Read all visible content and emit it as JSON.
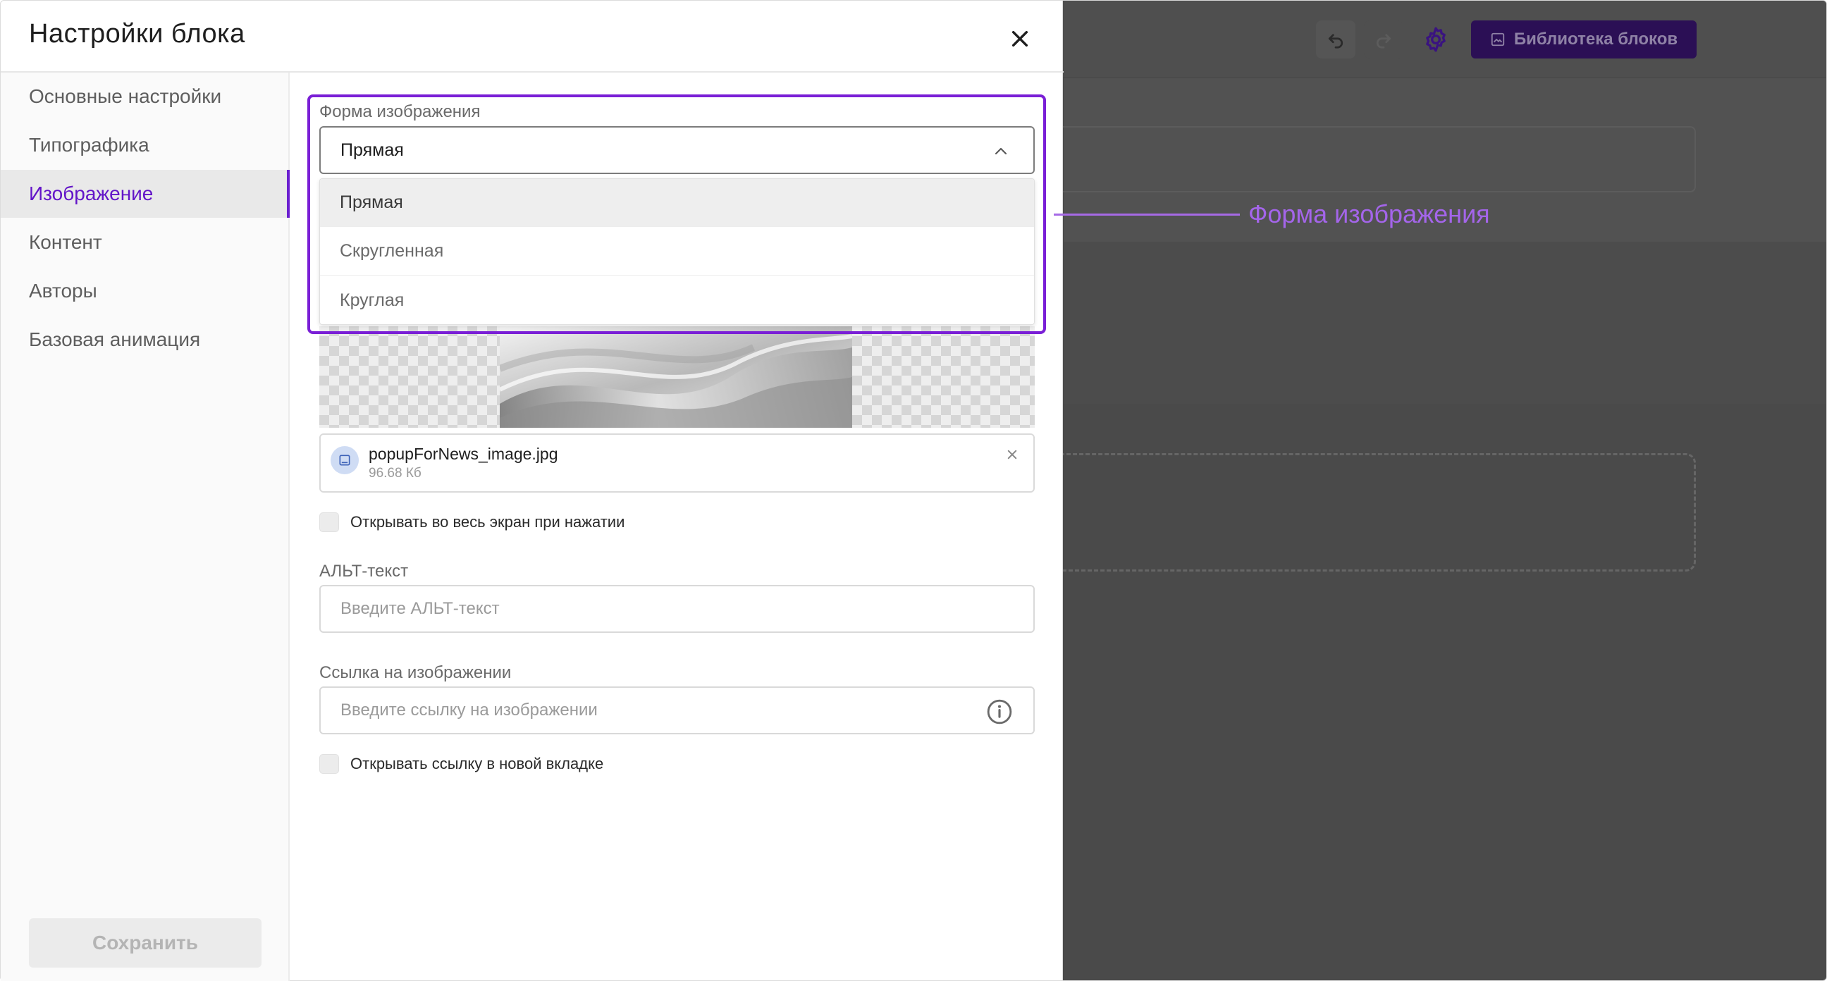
{
  "editor": {
    "library_label": "Библиотека блоков",
    "icons": {
      "undo": "undo-icon",
      "redo": "redo-icon",
      "settings": "gear-icon",
      "library": "image-icon"
    },
    "colors": {
      "accent": "#6a1fd0",
      "library_button": "#2b0f55"
    }
  },
  "panel": {
    "title": "Настройки блока",
    "close_icon": "close-icon",
    "save_label": "Сохранить"
  },
  "sidebar": {
    "items": [
      {
        "label": "Основные настройки",
        "active": false
      },
      {
        "label": "Типографика",
        "active": false
      },
      {
        "label": "Изображение",
        "active": true
      },
      {
        "label": "Контент",
        "active": false
      },
      {
        "label": "Авторы",
        "active": false
      },
      {
        "label": "Базовая анимация",
        "active": false
      }
    ]
  },
  "image_shape": {
    "label": "Форма изображения",
    "selected": "Прямая",
    "options": [
      "Прямая",
      "Скругленная",
      "Круглая"
    ],
    "expanded": true
  },
  "callout": {
    "label": "Форма изображения"
  },
  "file": {
    "name": "popupForNews_image.jpg",
    "size": "96.68 Кб"
  },
  "fullscreen_checkbox": {
    "label": "Открывать во весь экран при нажатии",
    "checked": false
  },
  "alt_text": {
    "label": "АЛЬТ-текст",
    "value": "",
    "placeholder": "Введите АЛЬТ-текст"
  },
  "image_link": {
    "label": "Ссылка на изображении",
    "value": "",
    "placeholder": "Введите ссылку на изображении"
  },
  "new_tab_checkbox": {
    "label": "Открывать ссылку в новой вкладке",
    "checked": false
  }
}
